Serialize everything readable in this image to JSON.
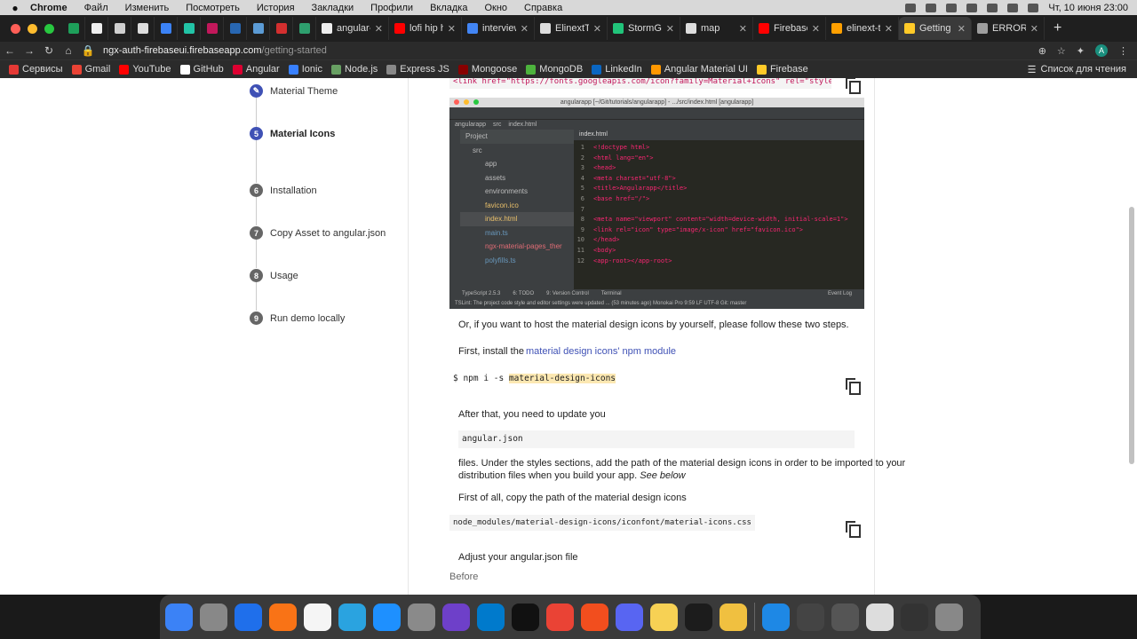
{
  "menubar": {
    "app": "Chrome",
    "items": [
      "Файл",
      "Изменить",
      "Посмотреть",
      "История",
      "Закладки",
      "Профили",
      "Вкладка",
      "Окно",
      "Справка"
    ],
    "datetime": "Чт, 10 июня  23:00"
  },
  "tabs": [
    {
      "title": "",
      "favicon": "#1e9f5a",
      "pinned": true
    },
    {
      "title": "",
      "favicon": "#eeeeee",
      "pinned": true
    },
    {
      "title": "",
      "favicon": "#cfcfcf",
      "pinned": true
    },
    {
      "title": "",
      "favicon": "#dddddd",
      "pinned": true
    },
    {
      "title": "",
      "favicon": "#3b82f6",
      "pinned": true
    },
    {
      "title": "",
      "favicon": "#22c3a6",
      "pinned": true
    },
    {
      "title": "",
      "favicon": "#c2185b",
      "pinned": true
    },
    {
      "title": "",
      "favicon": "#2867b2",
      "pinned": true
    },
    {
      "title": "",
      "favicon": "#5b9bd5",
      "pinned": true
    },
    {
      "title": "",
      "favicon": "#d32f2f",
      "pinned": true
    },
    {
      "title": "",
      "favicon": "#2e9f6e",
      "pinned": true
    },
    {
      "title": "angular-lea",
      "favicon": "#eeeeee"
    },
    {
      "title": "lofi hip hop",
      "favicon": "#ff0000"
    },
    {
      "title": "interview q",
      "favicon": "#4285f4"
    },
    {
      "title": "ElinextTest",
      "favicon": "#dddddd"
    },
    {
      "title": "StormGain",
      "favicon": "#21c47a"
    },
    {
      "title": "map",
      "favicon": "#dddddd"
    },
    {
      "title": "Firebase G",
      "favicon": "#ff0000"
    },
    {
      "title": "elinext-tes",
      "favicon": "#ffa000"
    },
    {
      "title": "Getting Sta",
      "favicon": "#ffca28",
      "active": true
    },
    {
      "title": "ERROR Err",
      "favicon": "#9e9e9e"
    }
  ],
  "toolbar": {
    "url_host": "ngx-auth-firebaseui.firebaseapp.com",
    "url_path": "/getting-started",
    "avatar": "A"
  },
  "bookmarks": [
    {
      "label": "Сервисы",
      "color": "#e53935"
    },
    {
      "label": "Gmail",
      "color": "#ea4335"
    },
    {
      "label": "YouTube",
      "color": "#ff0000"
    },
    {
      "label": "GitHub",
      "color": "#ffffff"
    },
    {
      "label": "Angular",
      "color": "#dd0031"
    },
    {
      "label": "Ionic",
      "color": "#3880ff"
    },
    {
      "label": "Node.js",
      "color": "#68a063"
    },
    {
      "label": "Express JS",
      "color": "#888888"
    },
    {
      "label": "Mongoose",
      "color": "#880000"
    },
    {
      "label": "MongoDB",
      "color": "#4db33d"
    },
    {
      "label": "LinkedIn",
      "color": "#0a66c2"
    },
    {
      "label": "Angular Material UI",
      "color": "#ff9800"
    },
    {
      "label": "Firebase",
      "color": "#ffca28"
    }
  ],
  "reading_list": "Список для чтения",
  "steps": [
    {
      "num": "",
      "label": "Material Theme",
      "icon": "pencil-icon"
    },
    {
      "num": "5",
      "label": "Material Icons",
      "active": true
    },
    {
      "num": "6",
      "label": "Installation"
    },
    {
      "num": "7",
      "label": "Copy Asset to angular.json"
    },
    {
      "num": "8",
      "label": "Usage"
    },
    {
      "num": "9",
      "label": "Run demo locally"
    }
  ],
  "content": {
    "top_code": "<link href=\"https://fonts.googleapis.com/icon?family=Material+Icons\" rel=\"stylesheet\">",
    "p1": "Or, if you want to host the material design icons by yourself, please follow these two steps.",
    "p2_prefix": "First, install the",
    "p2_link": "material design icons' npm module",
    "npm_cmd_prefix": "$ npm i -s ",
    "npm_cmd_pkg": "material-design-icons",
    "p3": "After that, you need to update you",
    "angular_json": "angular.json",
    "p4_line1": "files. Under the styles sections, add the path of the material design icons in order to be imported to your",
    "p4_line2": "distribution files when you build your app.",
    "p4_italic": "See below",
    "p5": "First of all, copy the path of the material design icons",
    "css_path": "node_modules/material-design-icons/iconfont/material-icons.css",
    "p6": "Adjust your angular.json file",
    "before": "Before"
  },
  "ide": {
    "title": "angularapp [~/Git/tutorials/angularapp] - .../src/index.html [angularapp]",
    "crumbs": [
      "angularapp",
      "src",
      "index.html"
    ],
    "project_label": "Project",
    "tree": [
      "src",
      "app",
      "assets",
      "environments",
      "favicon.ico",
      "index.html",
      "main.ts",
      "ngx-material-pages_ther",
      "polyfills.ts"
    ],
    "tab": "index.html",
    "code": [
      {
        "n": "1",
        "t": "<!doctype html>"
      },
      {
        "n": "2",
        "t": "<html lang=\"en\">"
      },
      {
        "n": "3",
        "t": "<head>"
      },
      {
        "n": "4",
        "t": "  <meta charset=\"utf-8\">"
      },
      {
        "n": "5",
        "t": "  <title>Angularapp</title>"
      },
      {
        "n": "6",
        "t": "  <base href=\"/\">"
      },
      {
        "n": "7",
        "t": ""
      },
      {
        "n": "8",
        "t": "  <meta name=\"viewport\" content=\"width=device-width, initial-scale=1\">"
      },
      {
        "n": "9",
        "t": "  <link rel=\"icon\" type=\"image/x-icon\" href=\"favicon.ico\">"
      },
      {
        "n": "10",
        "t": "</head>"
      },
      {
        "n": "11",
        "t": "<body>"
      },
      {
        "n": "12",
        "t": "  <app-root></app-root>"
      }
    ],
    "bottom_tabs": [
      "TypeScript 2.5.3",
      "6: TODO",
      "9: Version Control",
      "Terminal",
      "Event Log"
    ],
    "status": "TSLint: The project code style and editor settings were updated ... (53 minutes ago)    Monokai Pro    9:59  LF  UTF-8  Git: master"
  },
  "dock": [
    "#3b82f6",
    "#888888",
    "#1f6feb",
    "#f97316",
    "#f5f5f5",
    "#2aa3e0",
    "#1e90ff",
    "#8a8a8a",
    "#6e40c9",
    "#007acc",
    "#111111",
    "#ea4335",
    "#f24e1e",
    "#5865f2",
    "#f7d154",
    "#1c1c1c",
    "#f0c040",
    "#1e88e5",
    "#444444",
    "#555555",
    "#dddddd",
    "#333333",
    "#888888"
  ]
}
